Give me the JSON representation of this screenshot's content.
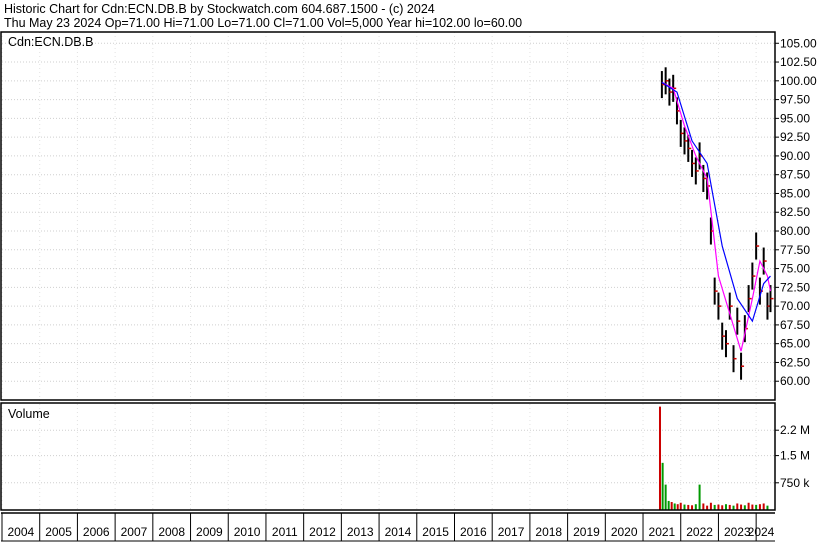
{
  "header": {
    "line1": "Historic Chart for Cdn:ECN.DB.B by Stockwatch.com 604.687.1500 - (c) 2024",
    "line2": "Thu May 23 2024   Op=71.00   Hi=71.00   Lo=71.00   Cl=71.00   Vol=5,000   Year hi=102.00   lo=60.00"
  },
  "price_panel_label": "Cdn:ECN.DB.B",
  "volume_panel_label": "Volume",
  "colors": {
    "price_bars": "#000000",
    "close_ticks": "#cc0000",
    "ma_short": "#ff00ff",
    "ma_long": "#0000ff",
    "volume_up": "#009900",
    "volume_down": "#cc0000",
    "frame": "#000000"
  },
  "chart_data": [
    {
      "type": "line",
      "panel": "price",
      "x_label_ticks": [
        "2004",
        "2005",
        "2006",
        "2007",
        "2008",
        "2009",
        "2010",
        "2011",
        "2012",
        "2013",
        "2014",
        "2015",
        "2016",
        "2017",
        "2018",
        "2019",
        "2020",
        "2021",
        "2022",
        "2023",
        "2024"
      ],
      "y_ticks": [
        "105.00",
        "102.50",
        "100.00",
        "97.50",
        "95.00",
        "92.50",
        "90.00",
        "87.50",
        "85.00",
        "82.50",
        "80.00",
        "77.50",
        "75.00",
        "72.50",
        "70.00",
        "67.50",
        "65.00",
        "62.50",
        "60.00"
      ],
      "ylim": [
        57.5,
        106.5
      ],
      "xlim": [
        2004.0,
        2024.5
      ],
      "grid": true,
      "series": [
        {
          "role": "price",
          "x": [
            2021.5,
            2021.6,
            2021.7,
            2021.8,
            2021.9,
            2022.0,
            2022.1,
            2022.2,
            2022.3,
            2022.4,
            2022.5,
            2022.6,
            2022.7,
            2022.8,
            2022.9,
            2023.0,
            2023.1,
            2023.2,
            2023.3,
            2023.4,
            2023.5,
            2023.6,
            2023.7,
            2023.8,
            2023.9,
            2024.0,
            2024.1,
            2024.2,
            2024.3,
            2024.38
          ],
          "y": [
            99.5,
            100.0,
            98.5,
            99.0,
            96.0,
            93.0,
            92.0,
            91.0,
            89.0,
            88.0,
            90.0,
            87.0,
            86.0,
            80.0,
            72.0,
            70.0,
            66.0,
            65.0,
            70.0,
            63.0,
            68.0,
            62.0,
            67.0,
            71.0,
            74.0,
            78.0,
            72.0,
            76.0,
            70.0,
            71.0
          ]
        },
        {
          "role": "moving-average-short",
          "x": [
            2021.5,
            2021.8,
            2022.1,
            2022.4,
            2022.7,
            2023.0,
            2023.3,
            2023.6,
            2023.9,
            2024.1,
            2024.3,
            2024.38
          ],
          "y": [
            99.8,
            99.0,
            94.0,
            90.0,
            87.0,
            74.0,
            69.0,
            64.0,
            71.0,
            76.0,
            74.0,
            72.0
          ]
        },
        {
          "role": "moving-average-long",
          "x": [
            2021.5,
            2021.9,
            2022.3,
            2022.7,
            2023.1,
            2023.5,
            2023.9,
            2024.2,
            2024.38
          ],
          "y": [
            99.8,
            98.5,
            92.0,
            89.0,
            78.0,
            71.0,
            68.0,
            73.0,
            74.0
          ]
        }
      ]
    },
    {
      "type": "bar",
      "panel": "volume",
      "y_ticks": [
        "2.2 M",
        "1.5 M",
        "750 k"
      ],
      "ylim": [
        0,
        2950000
      ],
      "x": [
        2021.45,
        2021.52,
        2021.6,
        2021.68,
        2021.76,
        2021.84,
        2021.92,
        2022.0,
        2022.1,
        2022.2,
        2022.3,
        2022.4,
        2022.5,
        2022.6,
        2022.7,
        2022.8,
        2022.9,
        2023.0,
        2023.1,
        2023.2,
        2023.3,
        2023.4,
        2023.5,
        2023.6,
        2023.7,
        2023.8,
        2023.9,
        2024.0,
        2024.1,
        2024.2,
        2024.3
      ],
      "values": [
        2850000,
        1300000,
        700000,
        250000,
        220000,
        180000,
        160000,
        200000,
        150000,
        140000,
        130000,
        160000,
        700000,
        180000,
        120000,
        200000,
        140000,
        150000,
        130000,
        160000,
        140000,
        120000,
        180000,
        150000,
        130000,
        200000,
        150000,
        140000,
        160000,
        180000,
        120000
      ],
      "directions": [
        "down",
        "up",
        "up",
        "up",
        "down",
        "up",
        "down",
        "down",
        "up",
        "down",
        "down",
        "up",
        "up",
        "down",
        "down",
        "down",
        "up",
        "down",
        "down",
        "up",
        "down",
        "up",
        "down",
        "down",
        "up",
        "down",
        "down",
        "up",
        "down",
        "down",
        "up"
      ]
    }
  ]
}
